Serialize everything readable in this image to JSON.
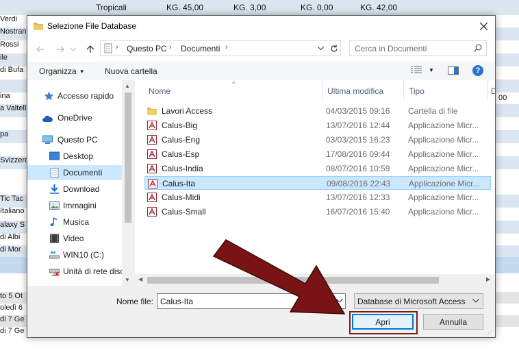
{
  "background_app": {
    "top_row": {
      "name": "Tropicali",
      "c1": "KG. 45,00",
      "c2": "KG. 3,00",
      "c3": "KG. 0,00",
      "c4": "KG. 42,00"
    },
    "left_rows": [
      "Verdi",
      "Nostran",
      "Rossi",
      "ile",
      "di Bufa",
      "",
      "ina",
      "a Valtell",
      "",
      "pa",
      "",
      "Svizzerc",
      "",
      "Tic Tac",
      "Italiano",
      "alaxy S",
      "di Albi",
      "di Mor"
    ],
    "bottom_rows": [
      "to  5 Ot",
      "oledì  6",
      "di  7 Ge",
      "di  7 Ge"
    ],
    "partial_right": "00"
  },
  "dialog": {
    "title": "Selezione File Database",
    "address": {
      "crumbs": [
        "Questo PC",
        "Documenti"
      ]
    },
    "search": {
      "placeholder": "Cerca in Documenti"
    },
    "toolbar": {
      "organize": "Organizza",
      "new_folder": "Nuova cartella"
    },
    "nav_pane": [
      {
        "label": "Accesso rapido",
        "icon": "star-icon"
      },
      {
        "label": "OneDrive",
        "icon": "cloud-icon"
      },
      {
        "label": "Questo PC",
        "icon": "computer-icon"
      },
      {
        "label": "Desktop",
        "icon": "desktop-icon"
      },
      {
        "label": "Documenti",
        "icon": "document-icon",
        "selected": true
      },
      {
        "label": "Download",
        "icon": "download-icon"
      },
      {
        "label": "Immagini",
        "icon": "image-icon"
      },
      {
        "label": "Musica",
        "icon": "music-icon"
      },
      {
        "label": "Video",
        "icon": "video-icon"
      },
      {
        "label": "WIN10 (C:)",
        "icon": "drive-icon"
      },
      {
        "label": "Unità di rete disc",
        "icon": "network-drive-icon"
      }
    ],
    "columns": {
      "name": "Nome",
      "modified": "Ultima modifica",
      "type": "Tipo",
      "extra": "D"
    },
    "files": [
      {
        "name": "Lavori Access",
        "modified": "04/03/2015 09:16",
        "type": "Cartella di file",
        "kind": "folder"
      },
      {
        "name": "Calus-Big",
        "modified": "13/07/2016 12:44",
        "type": "Applicazione Micr...",
        "kind": "access"
      },
      {
        "name": "Calus-Eng",
        "modified": "03/03/2015 16:23",
        "type": "Applicazione Micr...",
        "kind": "access"
      },
      {
        "name": "Calus-Esp",
        "modified": "17/08/2016 09:44",
        "type": "Applicazione Micr...",
        "kind": "access"
      },
      {
        "name": "Calus-India",
        "modified": "08/07/2016 10:59",
        "type": "Applicazione Micr...",
        "kind": "access"
      },
      {
        "name": "Calus-Ita",
        "modified": "09/08/2016 22:43",
        "type": "Applicazione Micr...",
        "kind": "access",
        "selected": true
      },
      {
        "name": "Calus-Midi",
        "modified": "13/07/2016 12:33",
        "type": "Applicazione Micr...",
        "kind": "access"
      },
      {
        "name": "Calus-Small",
        "modified": "16/07/2016 15:40",
        "type": "Applicazione Micr...",
        "kind": "access"
      }
    ],
    "filename": {
      "label": "Nome file:",
      "value": "Calus-Ita"
    },
    "filetype": {
      "value": "Database di Microsoft Access"
    },
    "buttons": {
      "open": "Apri",
      "cancel": "Annulla"
    }
  },
  "colors": {
    "selection": "#cce8ff",
    "accent": "#0078d7",
    "arrow": "#7a1c1c"
  }
}
